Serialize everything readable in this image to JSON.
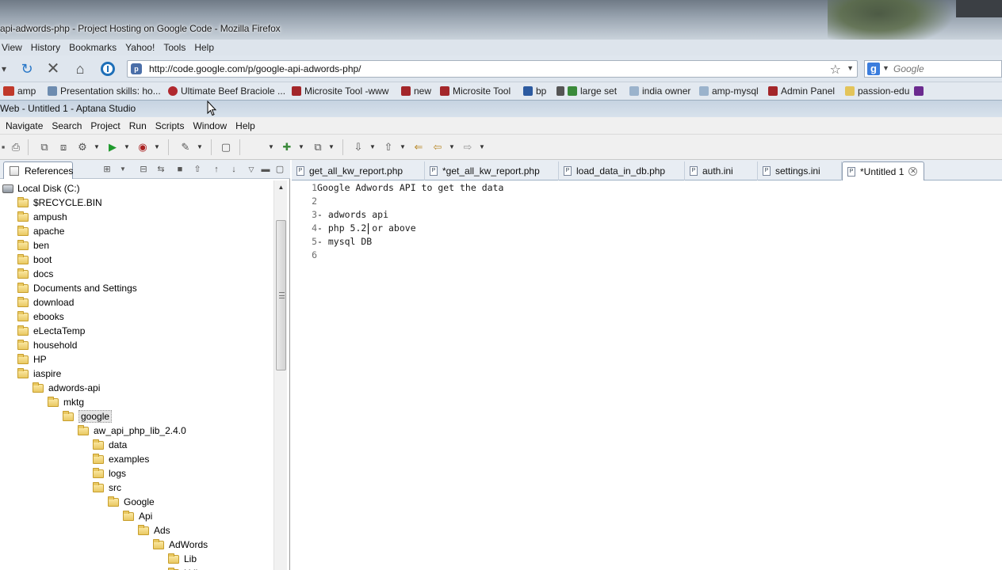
{
  "firefox": {
    "window_title": "api-adwords-php - Project Hosting on Google Code - Mozilla Firefox",
    "menu": [
      "View",
      "History",
      "Bookmarks",
      "Yahoo!",
      "Tools",
      "Help"
    ],
    "url": "http://code.google.com/p/google-api-adwords-php/",
    "search_placeholder": "Google",
    "bookmarks": [
      "amp",
      "Presentation skills: ho...",
      "Ultimate Beef Braciole ...",
      "Microsite Tool -www",
      "new",
      "Microsite Tool",
      "bp",
      "large set",
      "india owner",
      "amp-mysql",
      "Admin Panel",
      "passion-edu"
    ]
  },
  "aptana": {
    "window_title": "Web - Untitled  1 - Aptana Studio",
    "menu": [
      "Navigate",
      "Search",
      "Project",
      "Run",
      "Scripts",
      "Window",
      "Help"
    ],
    "references_tab": "References",
    "tree": [
      {
        "label": "Local Disk (C:)",
        "depth": 0,
        "kind": "drive"
      },
      {
        "label": "$RECYCLE.BIN",
        "depth": 1,
        "kind": "folder"
      },
      {
        "label": "ampush",
        "depth": 1,
        "kind": "folder"
      },
      {
        "label": "apache",
        "depth": 1,
        "kind": "folder"
      },
      {
        "label": "ben",
        "depth": 1,
        "kind": "folder"
      },
      {
        "label": "boot",
        "depth": 1,
        "kind": "folder"
      },
      {
        "label": "docs",
        "depth": 1,
        "kind": "folder"
      },
      {
        "label": "Documents and Settings",
        "depth": 1,
        "kind": "folder"
      },
      {
        "label": "download",
        "depth": 1,
        "kind": "folder"
      },
      {
        "label": "ebooks",
        "depth": 1,
        "kind": "folder"
      },
      {
        "label": "eLectaTemp",
        "depth": 1,
        "kind": "folder"
      },
      {
        "label": "household",
        "depth": 1,
        "kind": "folder"
      },
      {
        "label": "HP",
        "depth": 1,
        "kind": "folder"
      },
      {
        "label": "iaspire",
        "depth": 1,
        "kind": "folder"
      },
      {
        "label": "adwords-api",
        "depth": 2,
        "kind": "folder"
      },
      {
        "label": "mktg",
        "depth": 3,
        "kind": "folder"
      },
      {
        "label": "google",
        "depth": 4,
        "kind": "folder",
        "selected": true
      },
      {
        "label": "aw_api_php_lib_2.4.0",
        "depth": 5,
        "kind": "folder"
      },
      {
        "label": "data",
        "depth": 6,
        "kind": "folder"
      },
      {
        "label": "examples",
        "depth": 6,
        "kind": "folder"
      },
      {
        "label": "logs",
        "depth": 6,
        "kind": "folder"
      },
      {
        "label": "src",
        "depth": 6,
        "kind": "folder"
      },
      {
        "label": "Google",
        "depth": 7,
        "kind": "folder"
      },
      {
        "label": "Api",
        "depth": 8,
        "kind": "folder"
      },
      {
        "label": "Ads",
        "depth": 9,
        "kind": "folder"
      },
      {
        "label": "AdWords",
        "depth": 10,
        "kind": "folder"
      },
      {
        "label": "Lib",
        "depth": 11,
        "kind": "folder"
      },
      {
        "label": "Util",
        "depth": 11,
        "kind": "folder"
      }
    ],
    "editor_tabs": [
      {
        "label": "get_all_kw_report.php",
        "active": false
      },
      {
        "label": "*get_all_kw_report.php",
        "active": false
      },
      {
        "label": "load_data_in_db.php",
        "active": false
      },
      {
        "label": "auth.ini",
        "active": false
      },
      {
        "label": "settings.ini",
        "active": false
      },
      {
        "label": "*Untitled 1",
        "active": true
      }
    ],
    "code_lines": [
      {
        "num": "1",
        "text": "Google Adwords API to get the data"
      },
      {
        "num": "2",
        "text": ""
      },
      {
        "num": "3",
        "text": "- adwords api"
      },
      {
        "num": "4",
        "text": "- php 5.2 or above"
      },
      {
        "num": "5",
        "text": "- mysql DB"
      },
      {
        "num": "6",
        "text": ""
      }
    ]
  }
}
